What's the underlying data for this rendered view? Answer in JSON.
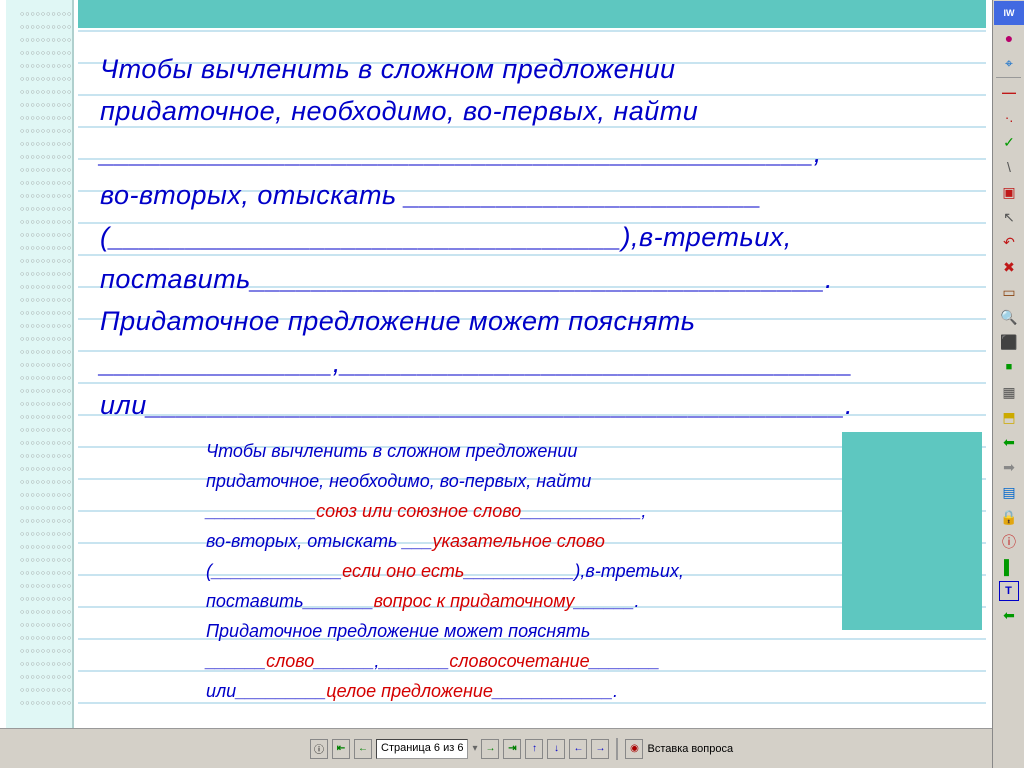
{
  "main_text": {
    "line1": "Чтобы вычленить в сложном предложении",
    "line2": "придаточное, необходимо, во-первых, найти",
    "line3": "______________________________________________,",
    "line4": "во-вторых, отыскать _______________________",
    "line5": "(_________________________________),в-третьих,",
    "line6": "поставить_____________________________________.",
    "line7": "Придаточное предложение может пояснять",
    "line8": "_______________,_________________________________",
    "line9": "или_____________________________________________."
  },
  "answer_block": {
    "l1": "Чтобы вычленить в сложном предложении",
    "l2": "придаточное, необходимо, во-первых, найти",
    "l3_pre": "___________",
    "l3_ans": "союз или союзное слово",
    "l3_post": "____________,",
    "l4_pre": "во-вторых, отыскать ___",
    "l4_ans": "указательное слово",
    "l5_pre": "(_____________",
    "l5_ans": "если оно есть",
    "l5_post": "___________),в-третьих,",
    "l6_pre": "поставить_______",
    "l6_ans": "вопрос к придаточному",
    "l6_post": "______.",
    "l7": "Придаточное предложение может пояснять",
    "l8_pre": "______",
    "l8_ans1": "слово",
    "l8_mid": "______,_______",
    "l8_ans2": "словосочетание",
    "l8_post": "_______",
    "l9_pre": "или_________",
    "l9_ans": "целое предложение",
    "l9_post": "____________."
  },
  "status": {
    "page_indicator": "Страница 6 из 6",
    "insert_question": "Вставка вопроса"
  },
  "toolbar_icons": [
    "IW",
    "●",
    "⌖",
    "—",
    "·.",
    "✓",
    "\\",
    "▣",
    "↖",
    "↶",
    "✖",
    "▭",
    "🔍",
    "⬛",
    "■",
    "▦",
    "⬒",
    "⬅",
    "➡",
    "▤",
    "🔒",
    "ⓘ",
    "▌",
    "T",
    "⬅"
  ]
}
